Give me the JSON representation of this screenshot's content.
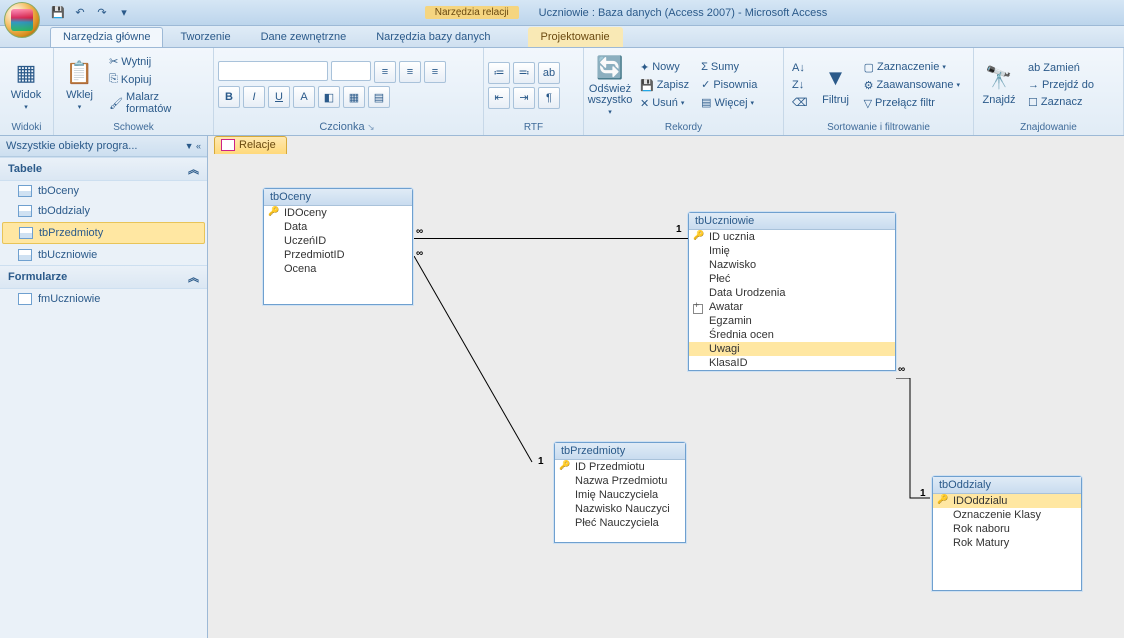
{
  "title": {
    "contextual": "Narzędzia relacji",
    "main": "Uczniowie : Baza danych (Access 2007) - Microsoft Access"
  },
  "qat": {
    "save": "save",
    "undo": "undo",
    "redo": "redo"
  },
  "tabs": {
    "home": "Narzędzia główne",
    "create": "Tworzenie",
    "external": "Dane zewnętrzne",
    "dbtools": "Narzędzia bazy danych",
    "design": "Projektowanie"
  },
  "ribbon": {
    "views": {
      "label": "Widoki",
      "btn": "Widok"
    },
    "clipboard": {
      "label": "Schowek",
      "paste": "Wklej",
      "cut": "Wytnij",
      "copy": "Kopiuj",
      "painter": "Malarz formatów"
    },
    "font": {
      "label": "Czcionka"
    },
    "rtf": {
      "label": "RTF"
    },
    "records": {
      "label": "Rekordy",
      "refresh": "Odśwież wszystko",
      "new": "Nowy",
      "save": "Zapisz",
      "delete": "Usuń",
      "totals": "Sumy",
      "spelling": "Pisownia",
      "more": "Więcej"
    },
    "sortfilter": {
      "label": "Sortowanie i filtrowanie",
      "filter": "Filtruj",
      "selection": "Zaznaczenie",
      "advanced": "Zaawansowane",
      "toggle": "Przełącz filtr"
    },
    "find": {
      "label": "Znajdowanie",
      "find": "Znajdź",
      "replace": "Zamień",
      "goto": "Przejdź do",
      "select": "Zaznacz"
    }
  },
  "nav": {
    "header": "Wszystkie obiekty progra...",
    "tables_h": "Tabele",
    "forms_h": "Formularze",
    "tables": [
      "tbOceny",
      "tbOddzialy",
      "tbPrzedmioty",
      "tbUczniowie"
    ],
    "forms": [
      "fmUczniowie"
    ]
  },
  "doc_tab": "Relacje",
  "rel": {
    "tbOceny": {
      "title": "tbOceny",
      "fields": [
        "IDOceny",
        "Data",
        "UczeńID",
        "PrzedmiotID",
        "Ocena"
      ],
      "pk": [
        0
      ]
    },
    "tbUczniowie": {
      "title": "tbUczniowie",
      "fields": [
        "ID ucznia",
        "Imię",
        "Nazwisko",
        "Płeć",
        "Data Urodzenia",
        "Awatar",
        "Egzamin",
        "Średnia ocen",
        "Uwagi",
        "KlasaID"
      ],
      "pk": [
        0
      ],
      "sel": 8,
      "expand": 5
    },
    "tbPrzedmioty": {
      "title": "tbPrzedmioty",
      "fields": [
        "ID Przedmiotu",
        "Nazwa Przedmiotu",
        "Imię Nauczyciela",
        "Nazwisko Nauczyci",
        "Płeć Nauczyciela"
      ],
      "pk": [
        0
      ]
    },
    "tbOddzialy": {
      "title": "tbOddzialy",
      "fields": [
        "IDOddzialu",
        "Oznaczenie Klasy",
        "Rok naboru",
        "Rok Matury"
      ],
      "pk": [
        0
      ],
      "sel": 0
    }
  },
  "conn_labels": {
    "one": "1",
    "many": "∞"
  }
}
